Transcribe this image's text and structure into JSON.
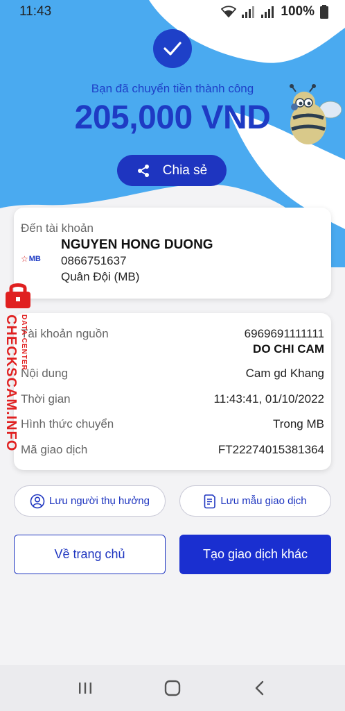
{
  "status_bar": {
    "time": "11:43",
    "battery": "100%",
    "icons": [
      "wifi-icon",
      "signal-icon",
      "signal-icon",
      "battery-icon"
    ]
  },
  "hero": {
    "success_message": "Bạn đã chuyển tiền thành công",
    "amount": "205,000 VND",
    "share_label": "Chia sẻ",
    "colors": {
      "accent": "#1e35c0",
      "background": "#4aaaf0"
    }
  },
  "recipient": {
    "to_label": "Đến tài khoản",
    "bank_logo": "MB",
    "name": "NGUYEN HONG DUONG",
    "account": "0866751637",
    "bank": "Quân Đội (MB)"
  },
  "details": {
    "source_label": "Tài khoản nguồn",
    "source_account": "6969691111111",
    "source_name": "DO CHI CAM",
    "content_label": "Nội dung",
    "content_value": "Cam gd Khang",
    "time_label": "Thời gian",
    "time_value": "11:43:41, 01/10/2022",
    "method_label": "Hình thức chuyển",
    "method_value": "Trong MB",
    "tx_code_label": "Mã giao dịch",
    "tx_code_value": "FT22274015381364"
  },
  "actions": {
    "save_payee": "Lưu người thụ hưởng",
    "save_template": "Lưu mẫu giao dịch",
    "home": "Về trang chủ",
    "new_transaction": "Tạo giao dịch khác"
  },
  "watermark": {
    "main": "CHECKSCAM.INFO",
    "sub": "DATA CENTER"
  }
}
